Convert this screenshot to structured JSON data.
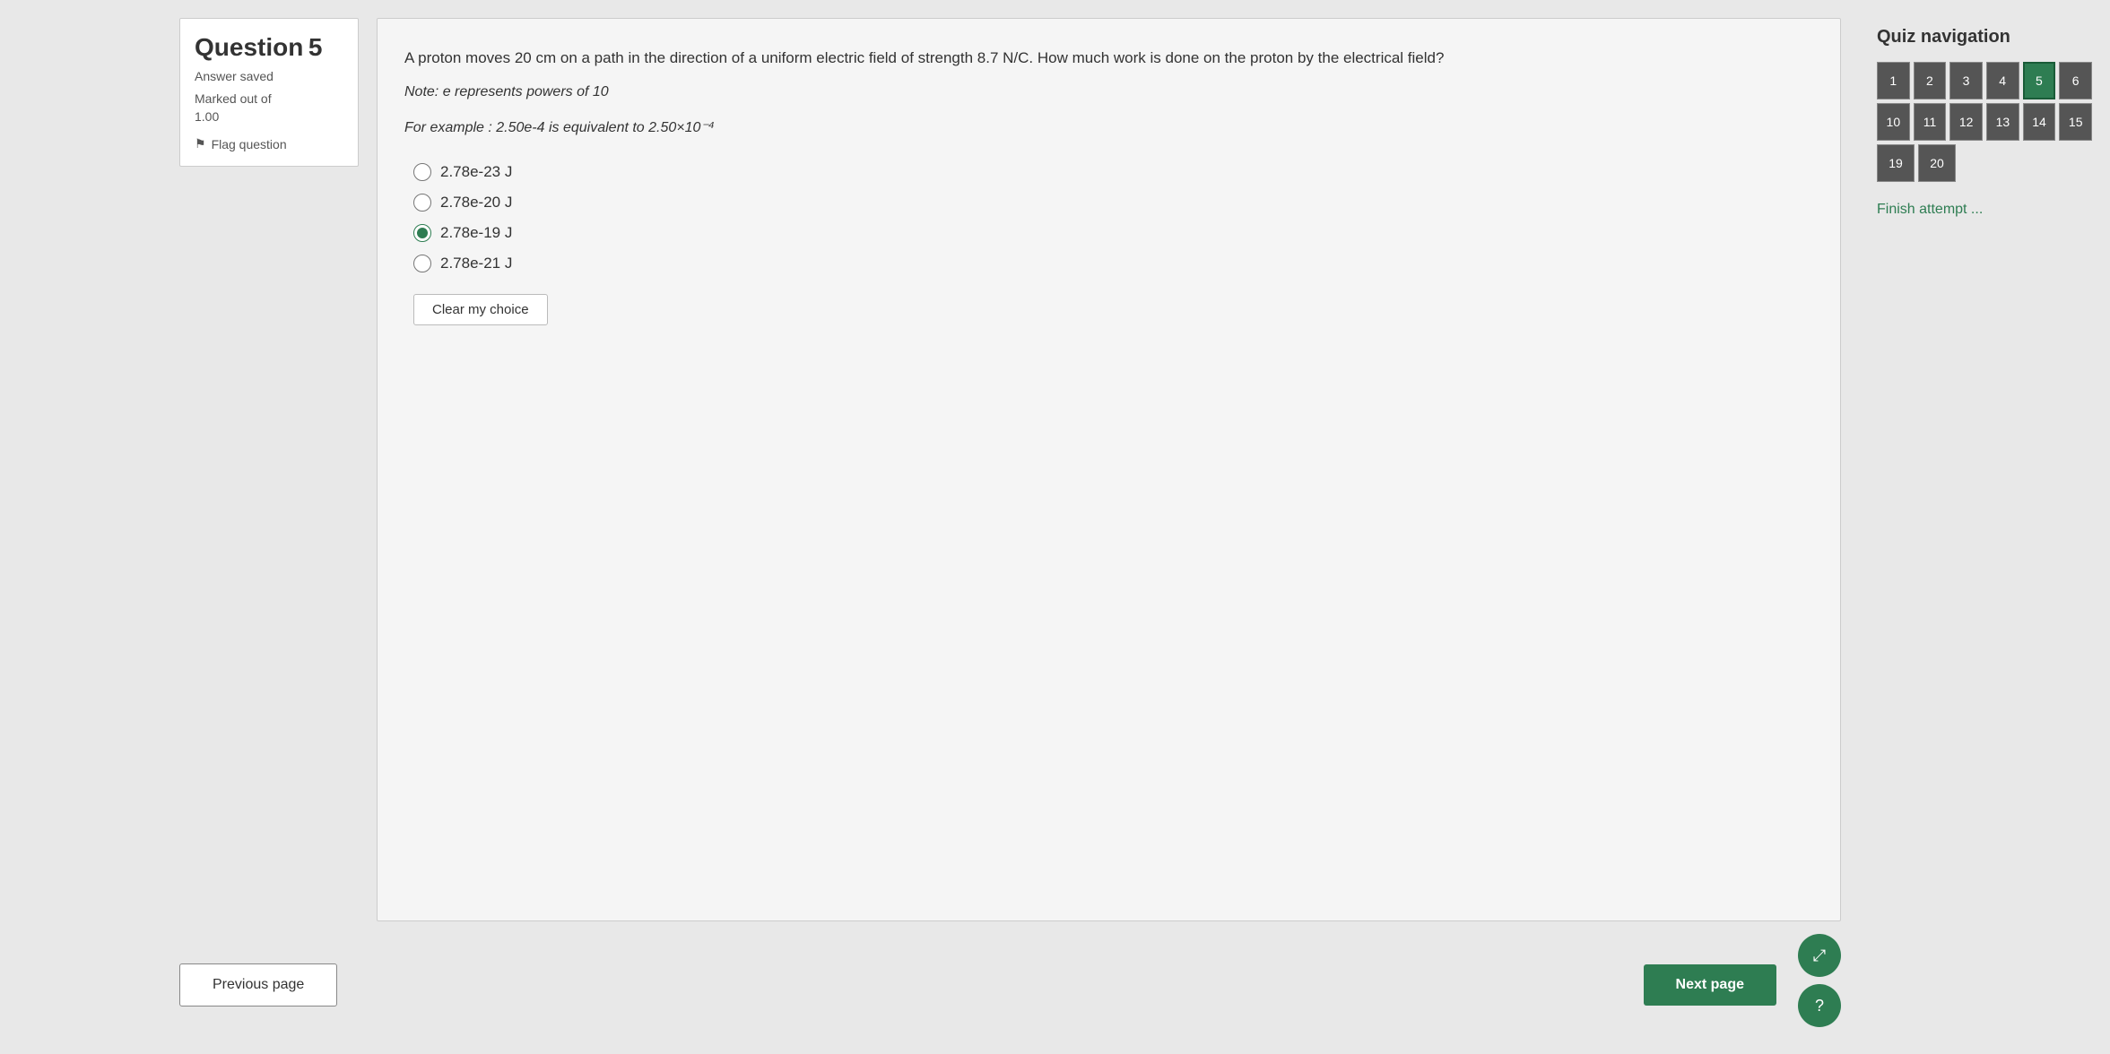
{
  "question": {
    "label": "Question",
    "number": "5",
    "status": "Answer saved",
    "marked_out_label": "Marked out of",
    "marked_out_value": "1.00",
    "flag_label": "Flag question",
    "text": "A proton moves 20 cm on a path in the direction of a uniform electric field of strength 8.7 N/C. How much work is done on the proton by the electrical field?",
    "note": "Note: e represents powers of 10",
    "example": "For example : 2.50e-4 is equivalent to 2.50×10⁻⁴",
    "options": [
      {
        "id": "opt1",
        "label": "2.78e-23 J",
        "selected": false
      },
      {
        "id": "opt2",
        "label": "2.78e-20 J",
        "selected": false
      },
      {
        "id": "opt3",
        "label": "2.78e-19 J",
        "selected": true
      },
      {
        "id": "opt4",
        "label": "2.78e-21 J",
        "selected": false
      }
    ],
    "clear_choice_label": "Clear my choice"
  },
  "navigation": {
    "prev_label": "Previous page",
    "next_label": "Next page",
    "quiz_nav_title": "Quiz navigation",
    "finish_attempt_label": "Finish attempt ...",
    "cells": [
      {
        "num": "1"
      },
      {
        "num": "2"
      },
      {
        "num": "3"
      },
      {
        "num": "4"
      },
      {
        "num": "5",
        "active": true
      },
      {
        "num": "6"
      },
      {
        "num": "10"
      },
      {
        "num": "11"
      },
      {
        "num": "12"
      },
      {
        "num": "13"
      },
      {
        "num": "14"
      },
      {
        "num": "15"
      },
      {
        "num": "19"
      },
      {
        "num": "20"
      }
    ],
    "float_expand_icon": "⤢",
    "float_help_icon": "?"
  }
}
